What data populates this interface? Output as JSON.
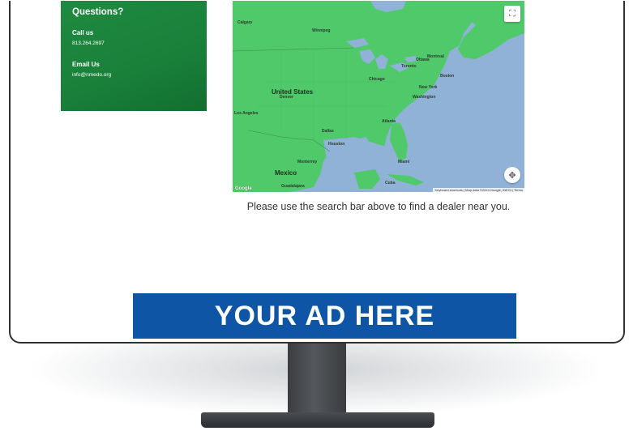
{
  "contact": {
    "title": "Questions?",
    "call_label": "Call us",
    "phone": "813.264.2697",
    "email_label": "Email Us",
    "email": "info@nmedo.org"
  },
  "map": {
    "labels": {
      "us": "United States",
      "mexico": "Mexico",
      "cuba": "Cuba",
      "canada_area": "Calgary",
      "winnipeg": "Winnipeg",
      "chicago": "Chicago",
      "new_york": "New York",
      "washington": "Washington",
      "dallas": "Dallas",
      "houston": "Houston",
      "atlanta": "Atlanta",
      "los_angeles": "Los Angeles",
      "denver": "Denver",
      "toronto": "Toronto",
      "montreal": "Montreal",
      "ottawa": "Ottawa",
      "boston": "Boston",
      "miami": "Miami",
      "guadalajara": "Guadalajara",
      "monterrey": "Monterrey"
    },
    "google": "Google",
    "attribution": "Keyboard shortcuts | Map data ©2024 Google, INEGI | Terms",
    "fullscreen_icon": "fullscreen-icon",
    "locate_icon": "locate-icon"
  },
  "helper_text": "Please use the search bar above to find a dealer near you.",
  "ad_banner": "YOUR AD HERE",
  "colors": {
    "card_green": "#1f8a40",
    "land_green": "#4fc96a",
    "water_blue": "#8fb2d6",
    "ad_blue": "#0e56a5"
  }
}
